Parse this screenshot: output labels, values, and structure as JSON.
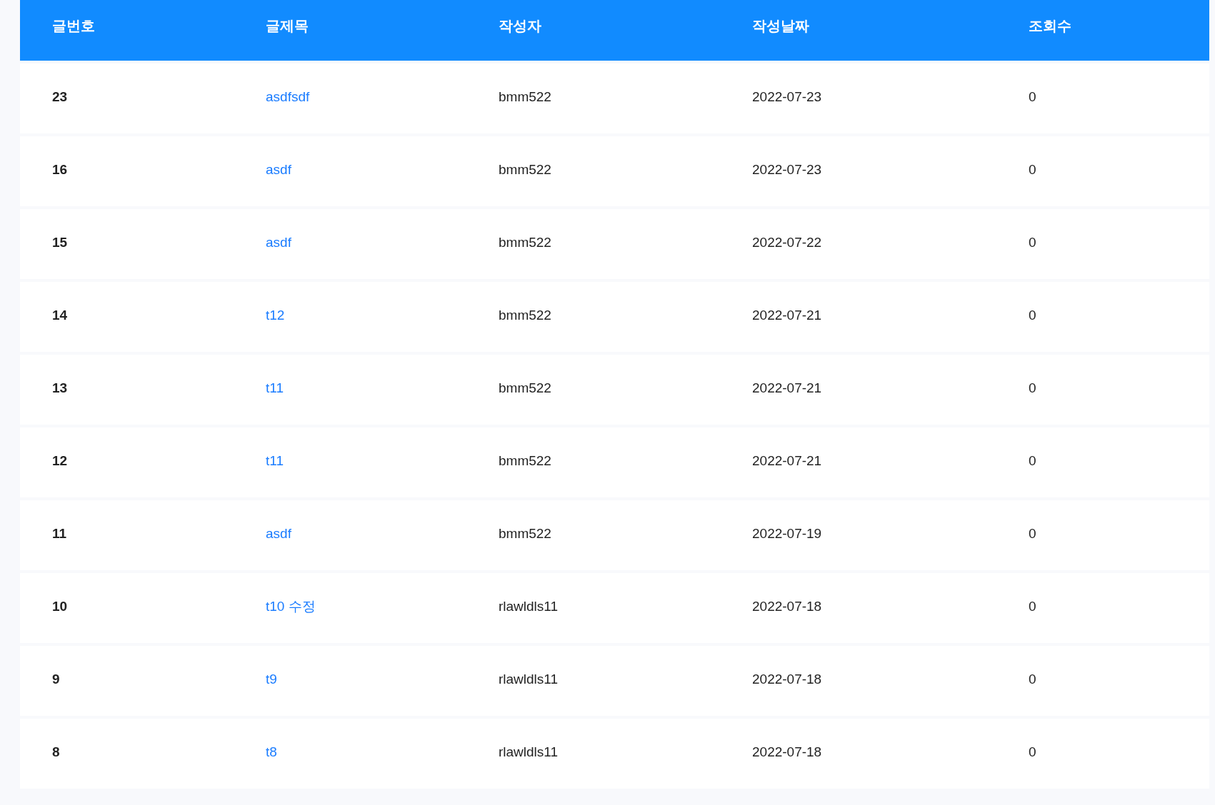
{
  "table": {
    "columns": [
      "글번호",
      "글제목",
      "작성자",
      "작성날짜",
      "조회수"
    ],
    "rows": [
      {
        "number": "23",
        "title": "asdfsdf",
        "author": "bmm522",
        "date": "2022-07-23",
        "views": "0"
      },
      {
        "number": "16",
        "title": "asdf",
        "author": "bmm522",
        "date": "2022-07-23",
        "views": "0"
      },
      {
        "number": "15",
        "title": "asdf",
        "author": "bmm522",
        "date": "2022-07-22",
        "views": "0"
      },
      {
        "number": "14",
        "title": "t12",
        "author": "bmm522",
        "date": "2022-07-21",
        "views": "0"
      },
      {
        "number": "13",
        "title": "t11",
        "author": "bmm522",
        "date": "2022-07-21",
        "views": "0"
      },
      {
        "number": "12",
        "title": "t11",
        "author": "bmm522",
        "date": "2022-07-21",
        "views": "0"
      },
      {
        "number": "11",
        "title": "asdf",
        "author": "bmm522",
        "date": "2022-07-19",
        "views": "0"
      },
      {
        "number": "10",
        "title": "t10 수정",
        "author": "rlawldls11",
        "date": "2022-07-18",
        "views": "0"
      },
      {
        "number": "9",
        "title": "t9",
        "author": "rlawldls11",
        "date": "2022-07-18",
        "views": "0"
      },
      {
        "number": "8",
        "title": "t8",
        "author": "rlawldls11",
        "date": "2022-07-18",
        "views": "0"
      }
    ]
  }
}
